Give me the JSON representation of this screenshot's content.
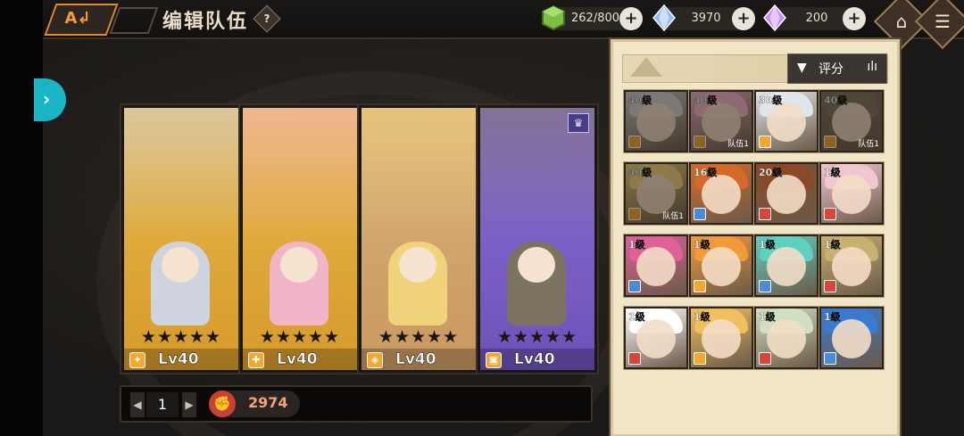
{
  "header": {
    "back_glyph": "A↲",
    "title": "编辑队伍",
    "help_label": "?"
  },
  "resources": [
    {
      "icon": "green-cube-icon",
      "value": "262/800",
      "color": "#7bc043"
    },
    {
      "icon": "blue-crystal-icon",
      "value": "3970",
      "color": "#8fb8ff"
    },
    {
      "icon": "purple-crystal-icon",
      "value": "200",
      "color": "#c58aff"
    }
  ],
  "nav": {
    "home_glyph": "⌂",
    "menu_glyph": "☰",
    "side_arrow": "›"
  },
  "team": {
    "cards": [
      {
        "stars": "★★★★★",
        "level": "Lv40",
        "class_color": "#f0a830",
        "bg_top": "#e7b84a",
        "bg_bottom": "#d79a2c",
        "chibi_color": "#cfd3e0",
        "crown": false
      },
      {
        "stars": "★★★★★",
        "level": "Lv40",
        "class_color": "#f0a830",
        "bg_top": "#e7b84a",
        "bg_bottom": "#d79a2c",
        "chibi_color": "#f2b5c8",
        "crown": false
      },
      {
        "stars": "★★★★★",
        "level": "Lv40",
        "class_color": "#f0a830",
        "bg_top": "#d9b27c",
        "bg_bottom": "#c99860",
        "chibi_color": "#f0d27a",
        "crown": false
      },
      {
        "stars": "★★★★★",
        "level": "Lv40",
        "class_color": "#f0a830",
        "bg_top": "#8a6fd6",
        "bg_bottom": "#6d52b8",
        "chibi_color": "#7c7460",
        "crown": true
      }
    ],
    "crown_glyph": "♛",
    "page": "1",
    "prev": "◀",
    "next": "▶",
    "power_icon": "✊",
    "power": "2974"
  },
  "panel": {
    "sort_label": "评分",
    "filter_glyph": "▼",
    "bars_glyph": "ılı",
    "heroes": [
      {
        "level": "40级",
        "team": "",
        "cls": "#f0a830",
        "hair": "#cfcfcf",
        "dim": true
      },
      {
        "level": "40级",
        "team": "队伍1",
        "cls": "#f0a830",
        "hair": "#f2b5c8",
        "dim": true
      },
      {
        "level": "30级",
        "team": "",
        "cls": "#f0a830",
        "hair": "#dde6ea",
        "dim": false
      },
      {
        "level": "40级",
        "team": "队伍1",
        "cls": "#f0a830",
        "hair": "#7c7460",
        "dim": true
      },
      {
        "level": "40级",
        "team": "队伍1",
        "cls": "#f0a830",
        "hair": "#f0d27a",
        "dim": true
      },
      {
        "level": "16级",
        "team": "",
        "cls": "#4a8ad8",
        "hair": "#d46a2a",
        "dim": false
      },
      {
        "level": "20级",
        "team": "",
        "cls": "#d8453a",
        "hair": "#8a4a2a",
        "dim": false
      },
      {
        "level": "1级",
        "team": "",
        "cls": "#d8453a",
        "hair": "#f2c6d0",
        "dim": false
      },
      {
        "level": "1级",
        "team": "",
        "cls": "#4a8ad8",
        "hair": "#e0609a",
        "dim": false
      },
      {
        "level": "1级",
        "team": "",
        "cls": "#f0a830",
        "hair": "#f29a3a",
        "dim": false
      },
      {
        "level": "1级",
        "team": "",
        "cls": "#4a8ad8",
        "hair": "#5fd0c0",
        "dim": false
      },
      {
        "level": "1级",
        "team": "",
        "cls": "#d8453a",
        "hair": "#c8b070",
        "dim": false
      },
      {
        "level": "1级",
        "team": "",
        "cls": "#d8453a",
        "hair": "#ffffff",
        "dim": false
      },
      {
        "level": "1级",
        "team": "",
        "cls": "#f0a830",
        "hair": "#f0c060",
        "dim": false
      },
      {
        "level": "1级",
        "team": "",
        "cls": "#d8453a",
        "hair": "#d0e0c0",
        "dim": false
      },
      {
        "level": "1级",
        "team": "",
        "cls": "#4a8ad8",
        "hair": "#3a7ad0",
        "dim": false
      }
    ]
  }
}
